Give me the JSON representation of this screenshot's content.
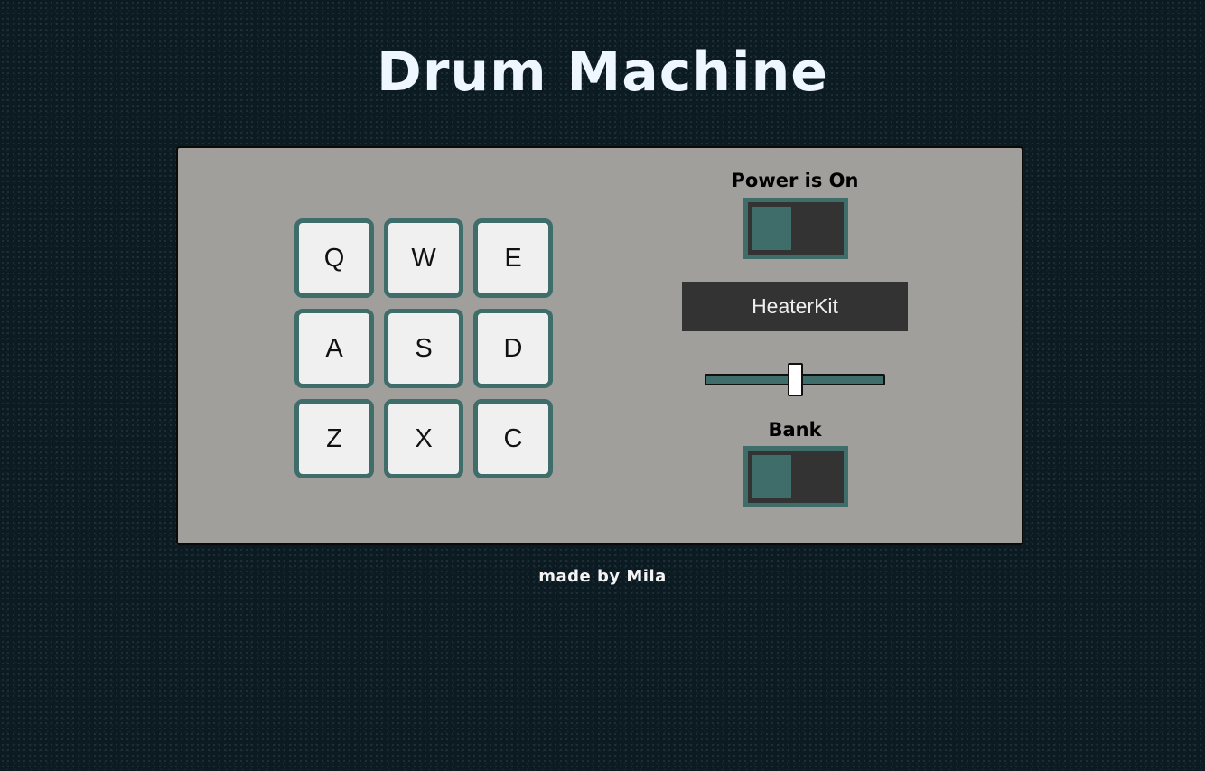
{
  "header": {
    "title": "Drum Machine"
  },
  "pads": [
    {
      "key": "Q"
    },
    {
      "key": "W"
    },
    {
      "key": "E"
    },
    {
      "key": "A"
    },
    {
      "key": "S"
    },
    {
      "key": "D"
    },
    {
      "key": "Z"
    },
    {
      "key": "X"
    },
    {
      "key": "C"
    }
  ],
  "controls": {
    "power_label": "Power is On",
    "display_text": "HeaterKit",
    "volume_level": 0.5,
    "bank_label": "Bank"
  },
  "footer": {
    "text": "made by Mila"
  },
  "colors": {
    "background": "#0c1a22",
    "panel": "#a19f9c",
    "accent": "#3f6d6a",
    "dark": "#333333",
    "pad": "#f0f0f0"
  }
}
